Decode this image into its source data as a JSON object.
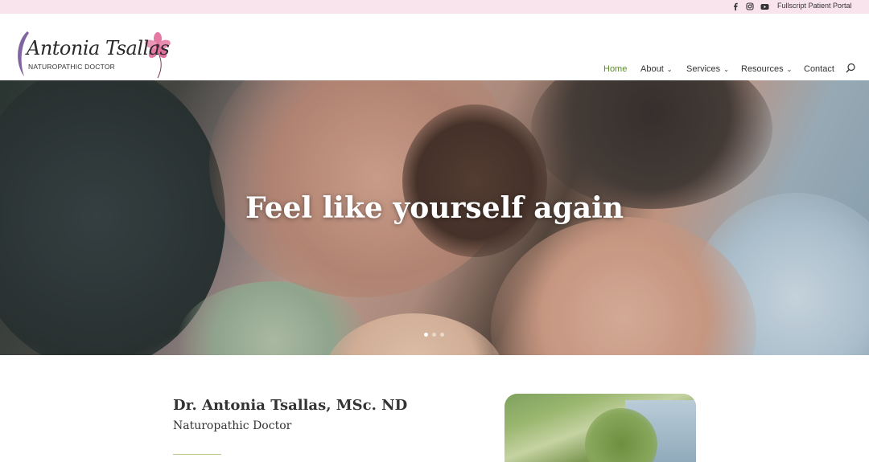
{
  "topbar": {
    "portal_label": "Fullscript Patient Portal",
    "icons": [
      "facebook-icon",
      "instagram-icon",
      "youtube-icon"
    ]
  },
  "logo": {
    "name": "Antonia Tsallas",
    "subtitle": "NATUROPATHIC DOCTOR"
  },
  "nav": {
    "home": "Home",
    "about": "About",
    "services": "Services",
    "resources": "Resources",
    "contact": "Contact",
    "active": "Home"
  },
  "hero": {
    "title": "Feel like yourself again",
    "slide_count": 3,
    "active_slide": 1
  },
  "intro": {
    "name": "Dr. Antonia Tsallas, MSc. ND",
    "title": "Naturopathic Doctor"
  },
  "colors": {
    "topbar_bg": "#f9e3ec",
    "nav_active": "#5b8a2a",
    "logo_flower": "#e47aa3",
    "divider": "#b5c98c"
  }
}
